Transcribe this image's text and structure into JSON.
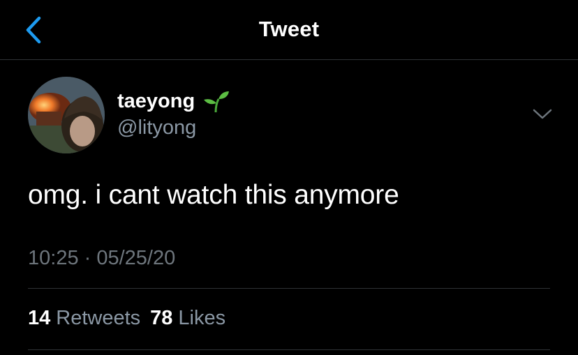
{
  "header": {
    "title": "Tweet",
    "back_icon": "chevron-left-icon"
  },
  "tweet": {
    "author": {
      "display_name": "taeyong",
      "name_emoji_icon": "sprout-icon",
      "handle": "@lityong"
    },
    "text": "omg. i cant watch this anymore",
    "timestamp": "10:25 · 05/25/20",
    "stats": {
      "retweets_count": "14",
      "retweets_label": "Retweets",
      "likes_count": "78",
      "likes_label": "Likes"
    },
    "more_icon": "chevron-down-icon"
  },
  "colors": {
    "background": "#000000",
    "accent": "#1d9bf0",
    "secondary_text": "#8b98a5",
    "divider": "#2f3336"
  }
}
